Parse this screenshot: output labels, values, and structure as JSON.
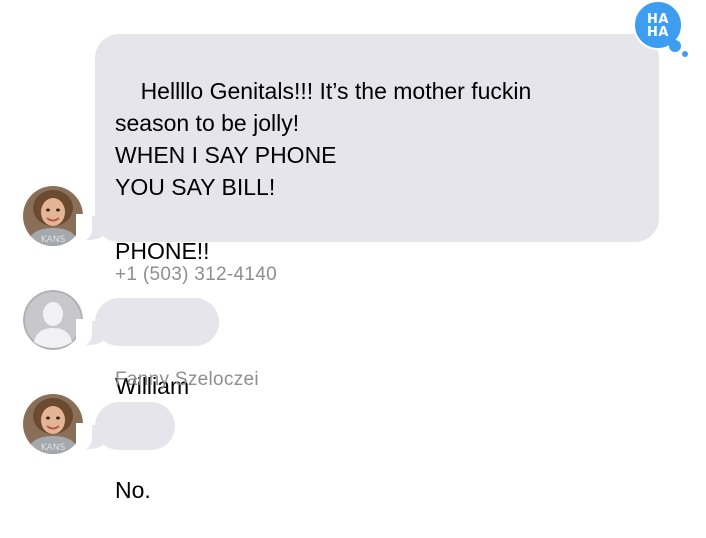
{
  "messages": [
    {
      "sender": "",
      "text": "Hellllo Genitals!!! It’s the mother fuckin\nseason to be jolly!\nWHEN I SAY PHONE\nYOU SAY BILL!\n\nPHONE!!",
      "tapback": {
        "line1": "HA",
        "line2": "HA",
        "color": "#3d9df0"
      }
    },
    {
      "sender": "+1 (503) 312-4140",
      "text": "William"
    },
    {
      "sender": "Fanny Szeloczei",
      "text": "No."
    }
  ],
  "colors": {
    "bubble": "#e6e5eb",
    "sender_text": "#8e8e93",
    "tapback": "#3d9df0"
  },
  "icons": {
    "tapback": "haha-tapback-icon",
    "avatar_photo": "avatar-photo",
    "avatar_placeholder": "person-silhouette-icon"
  }
}
